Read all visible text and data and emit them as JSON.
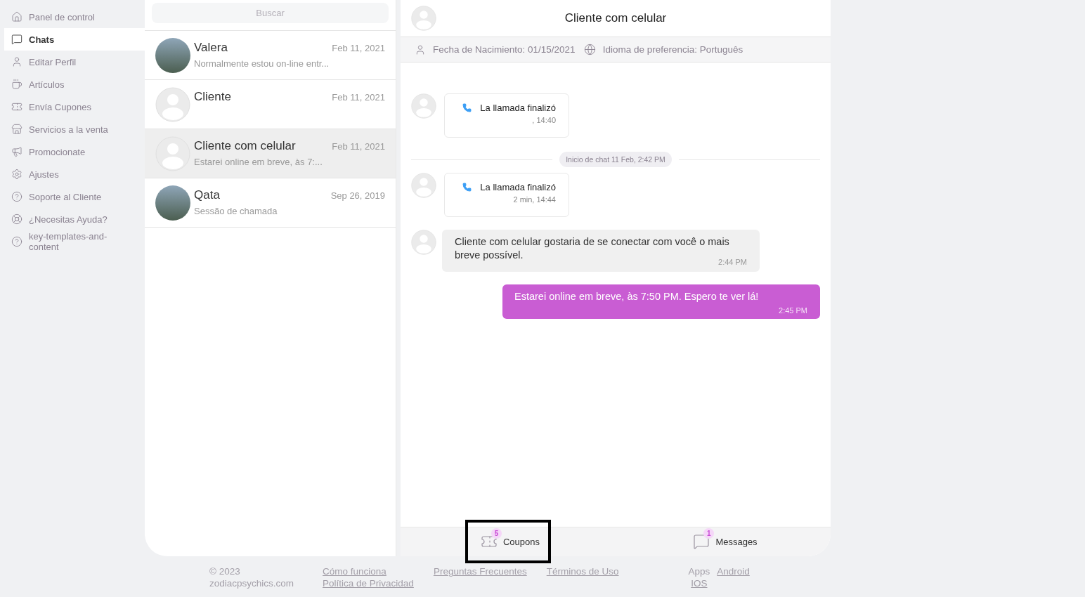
{
  "sidebar": {
    "items": [
      {
        "label": "Panel de control",
        "selected": false
      },
      {
        "label": "Chats",
        "selected": true
      },
      {
        "label": "Editar Perfil",
        "selected": false
      },
      {
        "label": "Artículos",
        "selected": false
      },
      {
        "label": "Envía Cupones",
        "selected": false
      },
      {
        "label": "Servicios a la venta",
        "selected": false
      },
      {
        "label": "Promocionate",
        "selected": false
      },
      {
        "label": "Ajustes",
        "selected": false
      },
      {
        "label": "Soporte al Cliente",
        "selected": false
      },
      {
        "label": "¿Necesitas Ayuda?",
        "selected": false
      },
      {
        "label": "key-templates-and-content",
        "selected": false
      }
    ]
  },
  "chat_list": {
    "search": {
      "placeholder": "Buscar"
    },
    "chats": [
      {
        "name": "Valera",
        "date": "Feb 11, 2021",
        "preview": "Normalmente estou on-line entr...",
        "kind": "photo",
        "selected": false
      },
      {
        "name": "Cliente",
        "date": "Feb 11, 2021",
        "kind": "default",
        "selected": false
      },
      {
        "name": "Cliente com celular",
        "date": "Feb 11, 2021",
        "preview": "Estarei online em breve, às 7:...",
        "kind": "default",
        "selected": true
      },
      {
        "name": "Qata",
        "date": "Sep 26, 2019",
        "preview": "Sessão de chamada",
        "kind": "photo",
        "selected": false
      }
    ]
  },
  "conversation": {
    "title": "Cliente com celular",
    "birth_date": "Fecha de Nacimiento: 01/15/2021",
    "language": "Idioma de preferencia: Português",
    "messages": [
      {
        "kind": "call",
        "title": "La llamada finalizó",
        "meta": ", 14:40"
      },
      {
        "kind": "divider",
        "text": "Inicio de chat 11 Feb, 2:42 PM"
      },
      {
        "kind": "call",
        "title": "La llamada finalizó",
        "meta": "2 min, 14:44"
      },
      {
        "kind": "incoming",
        "text": "Cliente com celular gostaria de se conectar com você o mais breve possível.",
        "time": "2:44 PM"
      },
      {
        "kind": "outgoing",
        "text": "Estarei online em breve, às 7:50 PM. Espero te ver lá!",
        "time": "2:45 PM"
      }
    ],
    "tabs": [
      {
        "label": "Coupons",
        "count": "5",
        "highlighted": true
      },
      {
        "label": "Messages",
        "count": "1",
        "highlighted": false
      }
    ]
  },
  "footer": {
    "copyright": "© 2023",
    "site": "zodiacpsychics.com",
    "links": [
      "Cómo funciona",
      "Preguntas Frecuentes",
      "Términos de Uso",
      "Política de Privacidad"
    ],
    "apps_label": "Apps",
    "apps": [
      "Android",
      "IOS"
    ]
  }
}
